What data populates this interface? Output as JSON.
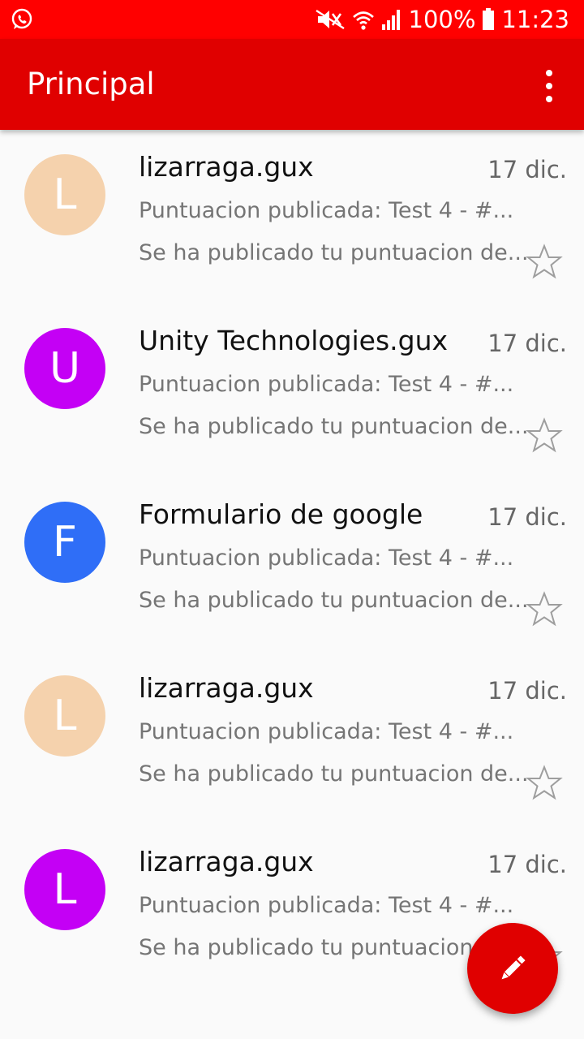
{
  "status_bar": {
    "battery": "100%",
    "time": "11:23",
    "icons": [
      "whatsapp-icon",
      "mute-icon",
      "wifi-icon",
      "signal-icon",
      "battery-icon"
    ]
  },
  "app_bar": {
    "title": "Principal",
    "menu_icon": "more-vertical-icon"
  },
  "emails": [
    {
      "initial": "L",
      "avatar_color": "#f5d2ad",
      "sender": "lizarraga.gux",
      "date": "17 dic.",
      "subject": "Puntuacion publicada: Test 4 - #...",
      "snippet": "Se ha publicado tu puntuacion de..."
    },
    {
      "initial": "U",
      "avatar_color": "#c400f5",
      "sender": "Unity Technologies.gux",
      "date": "17 dic.",
      "subject": "Puntuacion publicada: Test 4 - #...",
      "snippet": "Se ha publicado tu puntuacion de..."
    },
    {
      "initial": "F",
      "avatar_color": "#2f6ef7",
      "sender": "Formulario de google",
      "date": "17 dic.",
      "subject": "Puntuacion publicada: Test 4 - #...",
      "snippet": "Se ha publicado tu puntuacion de..."
    },
    {
      "initial": "L",
      "avatar_color": "#f5d2ad",
      "sender": "lizarraga.gux",
      "date": "17 dic.",
      "subject": "Puntuacion publicada: Test 4 - #...",
      "snippet": "Se ha publicado tu puntuacion de..."
    },
    {
      "initial": "L",
      "avatar_color": "#c400f5",
      "sender": "lizarraga.gux",
      "date": "17 dic.",
      "subject": "Puntuacion publicada: Test 4 - #...",
      "snippet": "Se ha publicado tu puntuacion de..."
    }
  ],
  "fab": {
    "icon": "pencil-icon"
  },
  "colors": {
    "status_bar": "#ff0000",
    "app_bar": "#e00000",
    "fab": "#e00000"
  }
}
